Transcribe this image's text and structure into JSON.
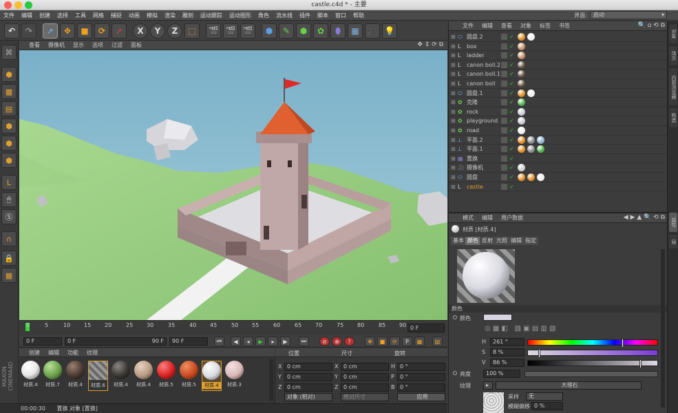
{
  "window": {
    "title": "castle.c4d * - 主要"
  },
  "menu": {
    "items": [
      "文件",
      "编辑",
      "创建",
      "选择",
      "工具",
      "网格",
      "捕捉",
      "动画",
      "模拟",
      "渲染",
      "雕刻",
      "运动跟踪",
      "运动图形",
      "角色",
      "流水线",
      "插件",
      "脚本",
      "窗口",
      "帮助"
    ],
    "layout_label": "界面:",
    "layout_value": "启动"
  },
  "toolbar": {
    "x_label": "X",
    "y_label": "Y",
    "z_label": "Z"
  },
  "viewport": {
    "menu": [
      "查看",
      "摄像机",
      "显示",
      "选项",
      "过滤",
      "面板"
    ]
  },
  "timeline": {
    "ticks": [
      "0",
      "5",
      "10",
      "15",
      "20",
      "25",
      "30",
      "35",
      "40",
      "45",
      "50",
      "55",
      "60",
      "65",
      "70",
      "75",
      "80",
      "85",
      "90"
    ],
    "end_frame": "0 F"
  },
  "transport": {
    "start": "0 F",
    "range_start": "0 F",
    "range_end": "90 F",
    "end": "90 F"
  },
  "materials": {
    "menu": [
      "创建",
      "编辑",
      "功能",
      "纹理"
    ],
    "items": [
      {
        "name": "材质.4",
        "color": "#e8e8e8"
      },
      {
        "name": "材质.7",
        "color": "#6aa04a"
      },
      {
        "name": "材质.4",
        "color": "#4a3a32"
      },
      {
        "name": "材质.6",
        "color": "#8a8a8a"
      },
      {
        "name": "材质.4",
        "color": "#3a3632"
      },
      {
        "name": "材质.4",
        "color": "#b89a82"
      },
      {
        "name": "材质.5",
        "color": "#d82020"
      },
      {
        "name": "材质.5",
        "color": "#c84820"
      },
      {
        "name": "材质.4",
        "color": "#d8d8e0"
      },
      {
        "name": "材质.3",
        "color": "#d8b8b8"
      }
    ]
  },
  "coords": {
    "headers": [
      "位置",
      "尺寸",
      "旋转"
    ],
    "rows": [
      {
        "axis": "X",
        "pos": "0 cm",
        "saxis": "X",
        "size": "0 cm",
        "raxis": "H",
        "rot": "0 °"
      },
      {
        "axis": "Y",
        "pos": "0 cm",
        "saxis": "Y",
        "size": "0 cm",
        "raxis": "P",
        "rot": "0 °"
      },
      {
        "axis": "Z",
        "pos": "0 cm",
        "saxis": "Z",
        "size": "0 cm",
        "raxis": "B",
        "rot": "0 °"
      }
    ],
    "mode": "对象 (相对)",
    "size_mode": "绝对尺寸",
    "apply": "应用"
  },
  "status": {
    "time": "00:00:30",
    "message": "置换 对象 [置换]"
  },
  "objects": {
    "menu": [
      "文件",
      "编辑",
      "查看",
      "对象",
      "标签",
      "书签"
    ],
    "rows": [
      {
        "name": "圆盘.2",
        "icon": "disc-icon"
      },
      {
        "name": "box",
        "icon": "null-icon"
      },
      {
        "name": "ladder",
        "icon": "null-icon"
      },
      {
        "name": "canon boll.2",
        "icon": "null-icon"
      },
      {
        "name": "canon boll.1",
        "icon": "null-icon"
      },
      {
        "name": "canon boll",
        "icon": "null-icon"
      },
      {
        "name": "圆盘.1",
        "icon": "disc-icon"
      },
      {
        "name": "克隆",
        "icon": "cloner-icon"
      },
      {
        "name": "rock",
        "icon": "cloner-icon"
      },
      {
        "name": "playground",
        "icon": "cloner-icon"
      },
      {
        "name": "road",
        "icon": "cloner-icon"
      },
      {
        "name": "平面.2",
        "icon": "plane-icon"
      },
      {
        "name": "平面.1",
        "icon": "plane-icon"
      },
      {
        "name": "置换",
        "icon": "displace-icon"
      },
      {
        "name": "摄像机",
        "icon": "camera-icon"
      },
      {
        "name": "圆盘",
        "icon": "disc-icon"
      },
      {
        "name": "castle",
        "icon": "null-icon"
      }
    ]
  },
  "attributes": {
    "menu": [
      "模式",
      "编辑",
      "用户数据"
    ],
    "title": "材质 [材质.4]",
    "tabs": [
      "基本",
      "颜色",
      "反射",
      "光照",
      "编辑",
      "指定"
    ],
    "section": "颜色",
    "color_label": "颜色",
    "H": "261 °",
    "S": "8 %",
    "V": "86 %",
    "brightness_label": "亮度",
    "brightness": "100 %",
    "texture_label": "纹理",
    "texture_name": "大理石",
    "sample_label": "采样",
    "sample_value": "无",
    "blur_offset_label": "模糊偏移",
    "blur_offset": "0 %",
    "H_label": "H",
    "S_label": "S",
    "V_label": "V"
  },
  "sidetabs": [
    "对象",
    "场次",
    "内容浏览器",
    "构造",
    "属性",
    "层"
  ]
}
